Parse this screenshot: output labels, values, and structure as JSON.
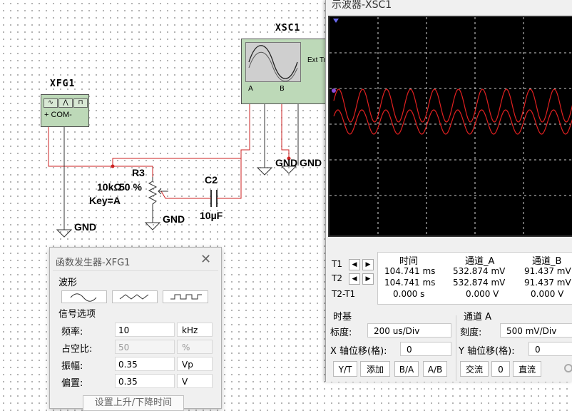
{
  "schematic": {
    "xfg_label": "XFG1",
    "xfg_com": "+ COM-",
    "xsc_label": "XSC1",
    "xsc_ext": "Ext Tr",
    "xsc_a": "A",
    "xsc_b": "B",
    "r3_label": "R3",
    "r3_value": "10kΩ",
    "r3_percent": "50 %",
    "r3_key": "Key=A",
    "c2_label": "C2",
    "c2_value": "10µF",
    "gnd1": "GND",
    "gnd2": "GND",
    "gnd3": "GND",
    "gnd4": "GND",
    "wire_color": "#cc2222"
  },
  "scope_window": {
    "title": "示波器-XSC1",
    "readout": {
      "rows": [
        "T1",
        "T2",
        "T2-T1"
      ],
      "headers": [
        "时间",
        "通道_A",
        "通道_B"
      ],
      "t1": [
        "104.741 ms",
        "532.874 mV",
        "91.437 mV"
      ],
      "t2": [
        "104.741 ms",
        "532.874 mV",
        "91.437 mV"
      ],
      "diff": [
        "0.000 s",
        "0.000 V",
        "0.000 V"
      ]
    },
    "timebase": {
      "title": "时基",
      "scale_label": "标度:",
      "scale_value": "200 us/Div",
      "xpos_label": "X 轴位移(格):",
      "xpos_value": "0",
      "buttons": [
        "Y/T",
        "添加",
        "B/A",
        "A/B"
      ]
    },
    "channel_a": {
      "title": "通道 A",
      "scale_label": "刻度:",
      "scale_value": "500 mV/Div",
      "ypos_label": "Y 轴位移(格):",
      "ypos_value": "0",
      "ac": "交流",
      "zero": "0",
      "dc": "直流"
    },
    "trace_color": "#e02020"
  },
  "fg_window": {
    "title": "函数发生器-XFG1",
    "close": "✕",
    "waveform_title": "波形",
    "signal_title": "信号选项",
    "fields": [
      {
        "label": "频率:",
        "value": "10",
        "unit": "kHz"
      },
      {
        "label": "占空比:",
        "value": "50",
        "unit": "%"
      },
      {
        "label": "振幅:",
        "value": "0.35",
        "unit": "Vp"
      },
      {
        "label": "偏置:",
        "value": "0.35",
        "unit": "V"
      }
    ],
    "rise_fall_button": "设置上升/下降时间"
  }
}
